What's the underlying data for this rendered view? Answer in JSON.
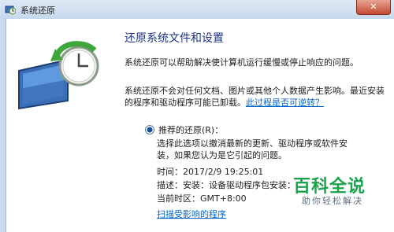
{
  "window": {
    "title": "系统还原",
    "close_label": "✕"
  },
  "main": {
    "heading": "还原系统文件和设置",
    "intro": "系统还原可以帮助解决使计算机运行缓慢或停止响应的问题。",
    "note": "系统还原不会对任何文档、图片或其他个人数据产生影响。最近安装的程序和驱动程序可能已卸载。",
    "note_link": "此过程是否可逆转？"
  },
  "recommended": {
    "label": "推荐的还原(R)：",
    "description": "选择此选项以撤消最新的更新、驱动程序或软件安装，如果您认为是它引起的问题。",
    "time_label": "时间：",
    "time_value": "2017/2/9 19:25:01",
    "desc_label": "描述：",
    "desc_value": "安装：设备驱动程序包安装：",
    "tz_label": "当前时区：",
    "tz_value": "GMT+8:00",
    "scan_link": "扫描受影响的程序"
  },
  "watermark": {
    "main": "百科全说",
    "sub": "助你轻松解决"
  },
  "colors": {
    "heading": "#1e3287",
    "link": "#0066cc",
    "watermark": "#1aa34a",
    "close": "#c24a32"
  }
}
